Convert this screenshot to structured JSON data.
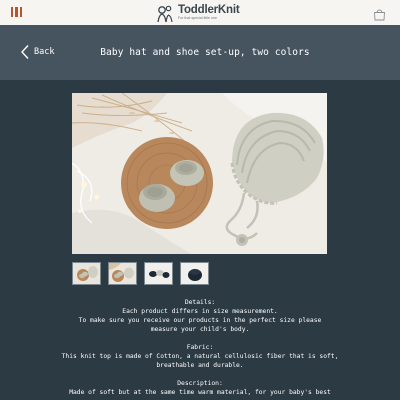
{
  "topbar": {
    "brand_name": "ToddlerKnit",
    "brand_tagline": "For that special little one",
    "menu_icon": "menu-icon",
    "cart_icon": "shopping-bag-icon"
  },
  "header": {
    "back_label": "Back",
    "title": "Baby hat and shoe set-up, two colors"
  },
  "product": {
    "thumbnail_count": 4
  },
  "description": {
    "details_heading": "Details:",
    "details_line1": "Each product differs in size measurement.",
    "details_line2": "To make sure you receive our products in the perfect size please",
    "details_line3": "measure your child's body.",
    "fabric_heading": "Fabric:",
    "fabric_line1": "This knit top is made of Cotton, a natural cellulosic fiber that is soft,",
    "fabric_line2": "breathable and durable.",
    "description_heading": "Description:",
    "description_line1": "Made of soft but at the same time warm material, for your baby's best"
  },
  "colors": {
    "topbar_bg": "#f6f5f2",
    "header_bg": "#46545f",
    "page_bg": "#2c3a44",
    "accent": "#b5562c"
  }
}
